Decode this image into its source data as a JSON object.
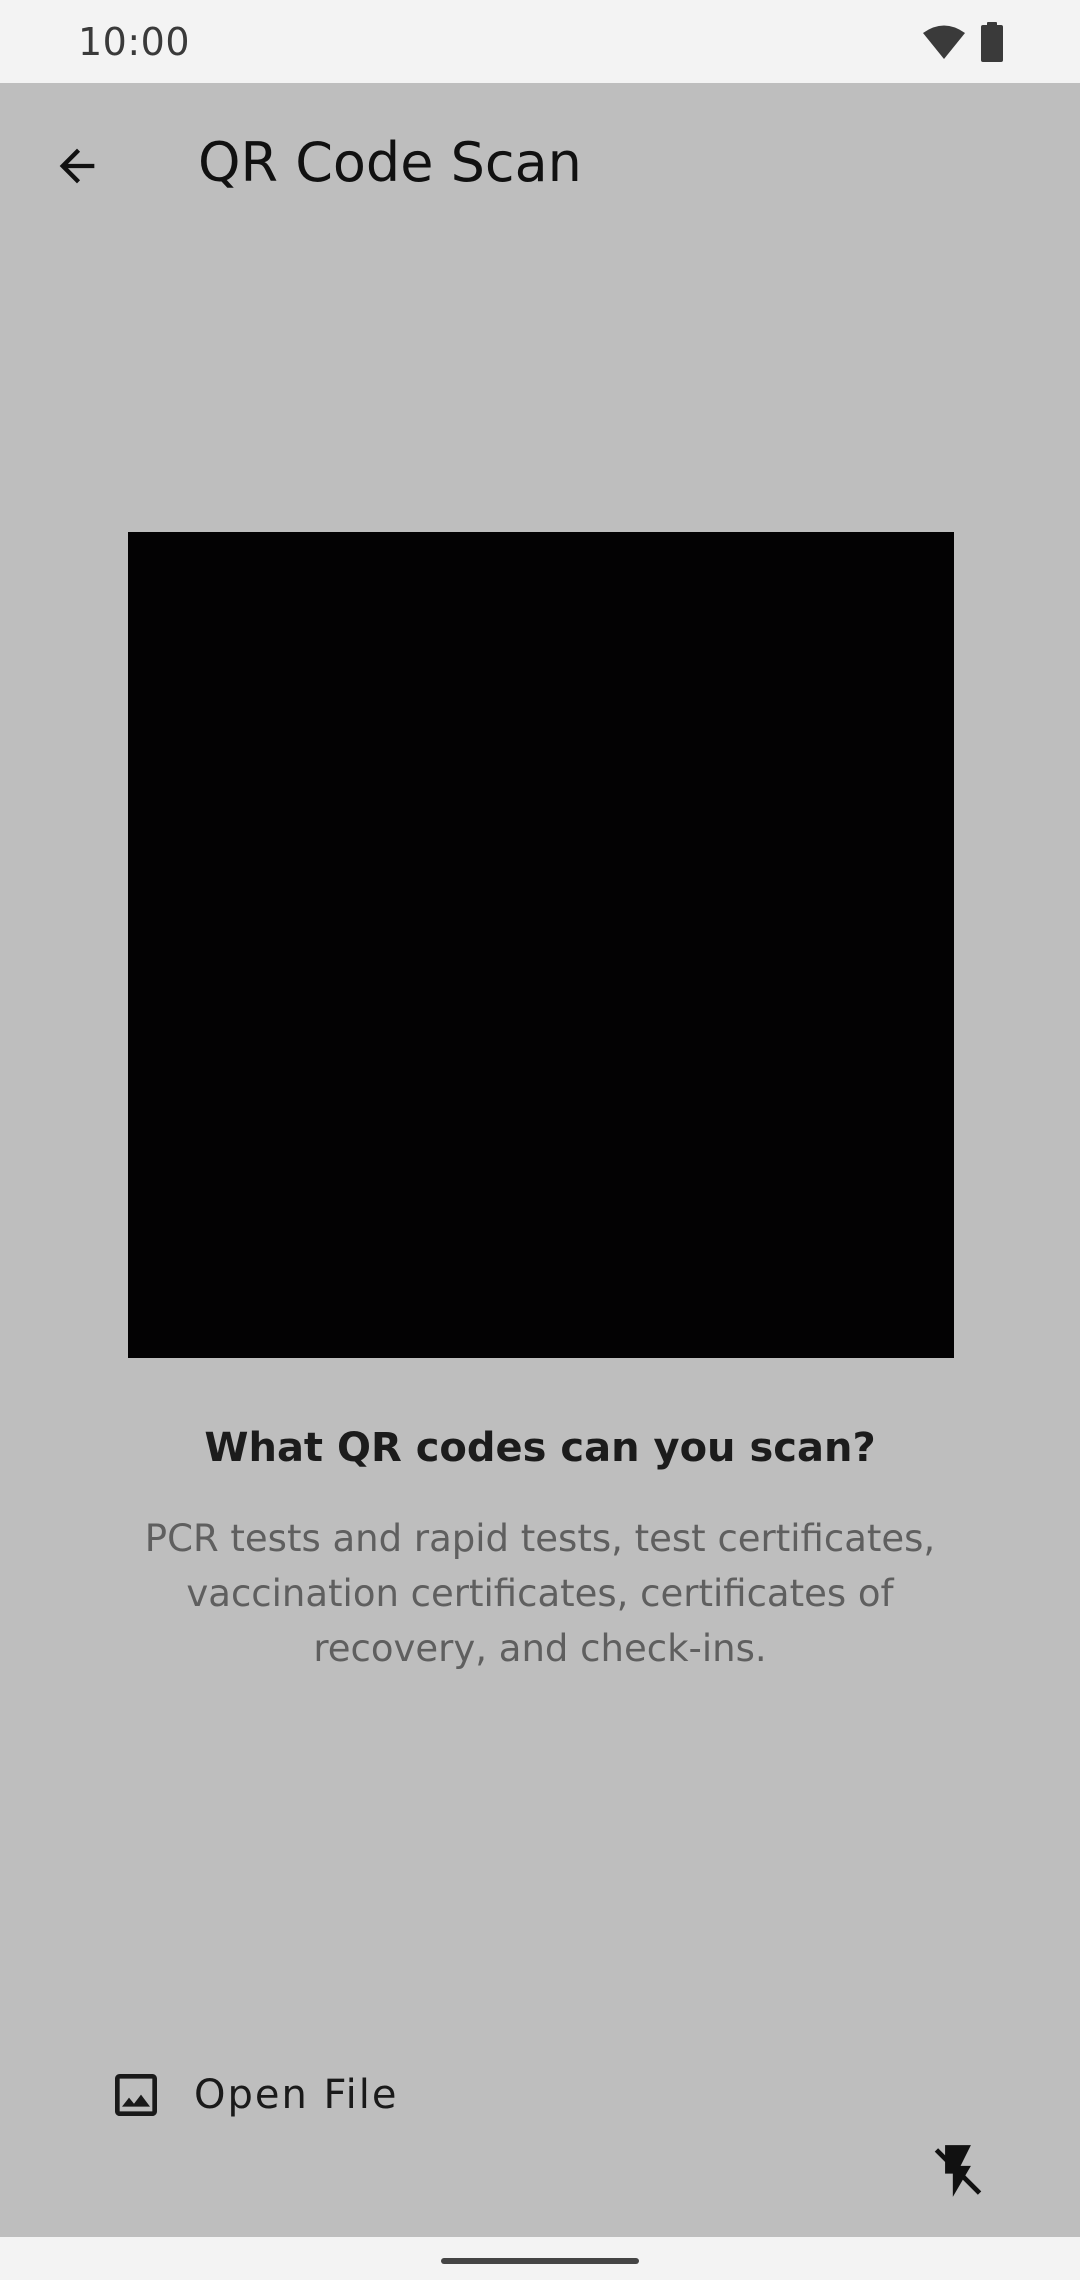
{
  "status_bar": {
    "time": "10:00",
    "icons": [
      "wifi-icon",
      "battery-icon"
    ]
  },
  "toolbar": {
    "back_icon": "arrow-back-icon",
    "title": "QR Code Scan"
  },
  "scanner": {
    "info_title": "What QR codes can you scan?",
    "info_body": "PCR tests and rapid tests, test certificates, vaccination certificates, certificates of recovery, and check-ins."
  },
  "actions": {
    "open_file_label": "Open File",
    "open_file_icon": "image-icon",
    "flash_icon": "flash-off-icon"
  },
  "colors": {
    "background": "#bebebe",
    "system_bars": "#f3f3f3",
    "camera_preview": "#030203"
  }
}
